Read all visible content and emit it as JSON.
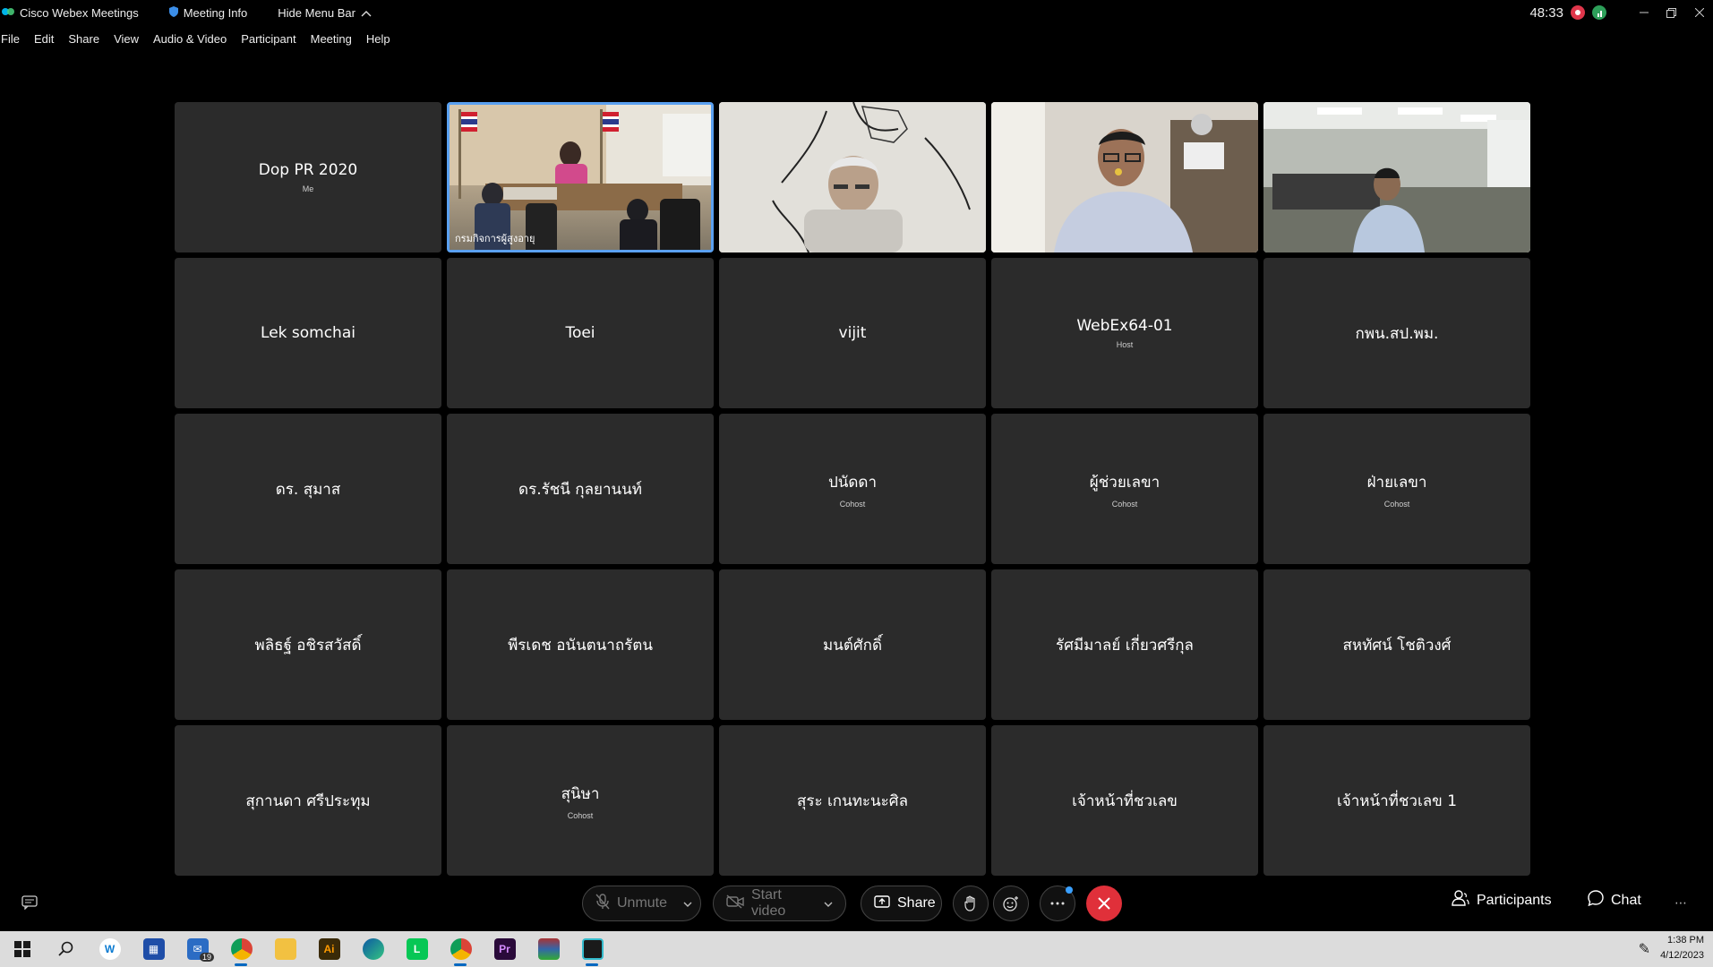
{
  "titlebar": {
    "app_name": "Cisco Webex Meetings",
    "meeting_info": "Meeting Info",
    "hide_menu": "Hide Menu Bar",
    "timer": "48:33"
  },
  "menu": [
    "File",
    "Edit",
    "Share",
    "View",
    "Audio & Video",
    "Participant",
    "Meeting",
    "Help"
  ],
  "participants": [
    {
      "name": "Dop PR 2020",
      "role": "Me",
      "video": false
    },
    {
      "name": "กรมกิจการผู้สูงอายุ",
      "role": "",
      "video": true,
      "active": true
    },
    {
      "name": "",
      "role": "",
      "video": true
    },
    {
      "name": "",
      "role": "",
      "video": true
    },
    {
      "name": "",
      "role": "",
      "video": true
    },
    {
      "name": "Lek somchai",
      "role": "",
      "video": false
    },
    {
      "name": "Toei",
      "role": "",
      "video": false
    },
    {
      "name": "vijit",
      "role": "",
      "video": false
    },
    {
      "name": "WebEx64-01",
      "role": "Host",
      "video": false
    },
    {
      "name": "กพน.สป.พม.",
      "role": "",
      "video": false
    },
    {
      "name": "ดร. สุมาส",
      "role": "",
      "video": false
    },
    {
      "name": "ดร.รัชนี กุลยานนท์",
      "role": "",
      "video": false
    },
    {
      "name": "ปนัดดา",
      "role": "Cohost",
      "video": false
    },
    {
      "name": "ผู้ช่วยเลขา",
      "role": "Cohost",
      "video": false
    },
    {
      "name": "ฝ่ายเลขา",
      "role": "Cohost",
      "video": false
    },
    {
      "name": "พลิธฐ์ อชิรสวัสดิ์",
      "role": "",
      "video": false
    },
    {
      "name": "พีรเดช อนันตนาถรัตน",
      "role": "",
      "video": false
    },
    {
      "name": "มนต์ศักดิ์",
      "role": "",
      "video": false
    },
    {
      "name": "รัศมีมาลย์ เกี่ยวศรีกุล",
      "role": "",
      "video": false
    },
    {
      "name": "สหทัศน์ โชติวงศ์",
      "role": "",
      "video": false
    },
    {
      "name": "สุกานดา ศรีประทุม",
      "role": "",
      "video": false
    },
    {
      "name": "สุนิษา",
      "role": "Cohost",
      "video": false
    },
    {
      "name": "สุระ เกนทะนะศิล",
      "role": "",
      "video": false
    },
    {
      "name": "เจ้าหน้าที่ชวเลข",
      "role": "",
      "video": false
    },
    {
      "name": "เจ้าหน้าที่ชวเลข 1",
      "role": "",
      "video": false
    }
  ],
  "controls": {
    "unmute": "Unmute",
    "start_video": "Start video",
    "share": "Share",
    "participants": "Participants",
    "chat": "Chat"
  },
  "taskbar": {
    "mail_badge": "19",
    "time": "1:38 PM",
    "date": "4/12/2023"
  },
  "colors": {
    "end_call": "#e0303a",
    "active_speaker": "#5aa0f0",
    "tile_bg": "#2b2b2b"
  }
}
